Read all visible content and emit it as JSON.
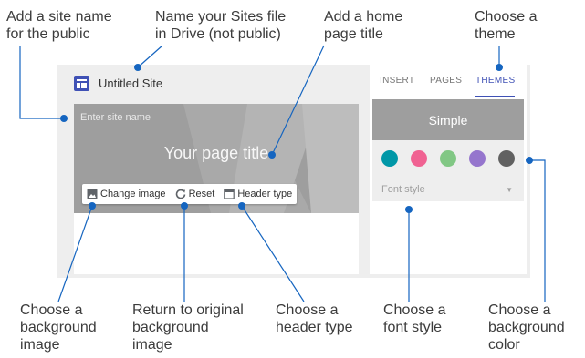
{
  "callouts": {
    "site_name": "Add a site name\nfor the public",
    "file_name": "Name your Sites file\nin Drive (not public)",
    "page_title": "Add a home\npage title",
    "theme": "Choose a\ntheme",
    "bg_image": "Choose a\nbackground\nimage",
    "reset": "Return to original\nbackground\nimage",
    "header_type": "Choose a\nheader type",
    "font_style": "Choose a\nfont style",
    "bg_color": "Choose a\nbackground\ncolor"
  },
  "editor": {
    "site_title": "Untitled Site",
    "site_name_placeholder": "Enter site name",
    "page_title": "Your page title",
    "toolbar": {
      "change_image": "Change image",
      "reset": "Reset",
      "header_type": "Header type"
    }
  },
  "panel": {
    "tabs": [
      "INSERT",
      "PAGES",
      "THEMES"
    ],
    "active_tab": "THEMES",
    "theme_name": "Simple",
    "swatches": [
      "#0097a7",
      "#f06292",
      "#81c784",
      "#9575cd",
      "#616161"
    ],
    "font_style_label": "Font style"
  },
  "colors": {
    "accent": "#3f51b5",
    "leader": "#1565c0"
  },
  "icons": [
    "site-logo-icon",
    "image-icon",
    "reset-icon",
    "header-type-icon",
    "dropdown-arrow-icon"
  ]
}
